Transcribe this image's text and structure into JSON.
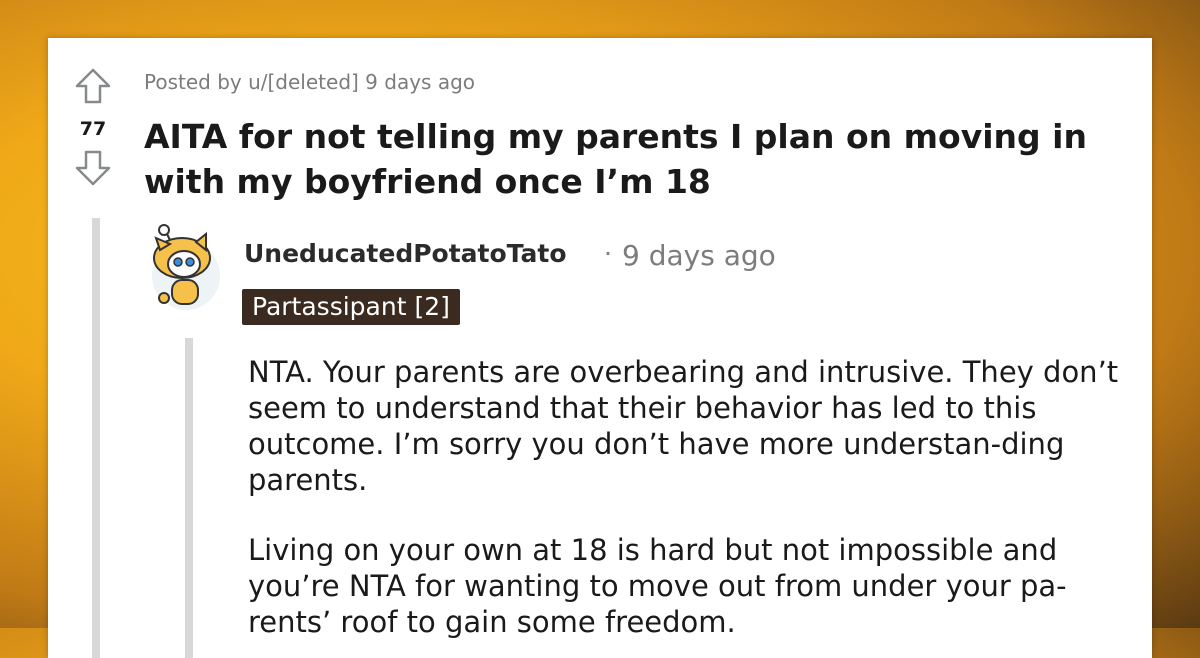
{
  "post": {
    "score": "77",
    "meta": "Posted by u/[deleted] 9 days ago",
    "title": "AITA for not telling my parents I plan on moving in with my boyfriend once I’m 18"
  },
  "comment": {
    "username": "UneducatedPotatoTato",
    "separator": "·",
    "time": "9 days ago",
    "flair": "Partassipant [2]",
    "paragraphs": [
      "NTA. Your parents are overbearing and intrusive. They don’t seem to understand that their behavior has led to this outcome. I’m sorry you don’t have more understan-ding parents.",
      "Living on your own at 18 is hard but not impossible and you’re NTA for wanting to move out from under your pa-rents’ roof to gain some freedom."
    ]
  },
  "icons": {
    "upvote": "upvote-arrow-icon",
    "downvote": "downvote-arrow-icon",
    "avatar": "snoo-avatar"
  }
}
